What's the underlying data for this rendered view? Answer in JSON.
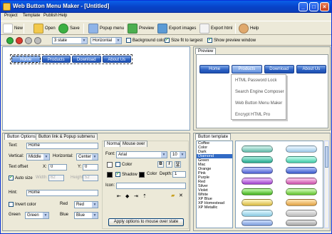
{
  "window": {
    "title": "Web Button Menu Maker - [Untitled]",
    "controls": {
      "minimize": "_",
      "maximize": "□",
      "close": "×"
    }
  },
  "menubar": [
    "Project",
    "Template",
    "Publish",
    "Help"
  ],
  "toolbar": {
    "new": "New",
    "open": "Open",
    "save": "Save",
    "popup_menu": "Popup menu",
    "preview": "Preview",
    "export_images": "Export images",
    "export_html": "Export html",
    "help": "Help"
  },
  "toolbar2": {
    "state_select": "3 state",
    "orientation_select": "Horizontal",
    "background_color": "Background color",
    "size_fit": "Size fit to largest",
    "show_preview": "Show preview window"
  },
  "editor": {
    "buttons": [
      "Home",
      "Products",
      "Download",
      "About Us"
    ]
  },
  "preview": {
    "tab": "Preview",
    "buttons": [
      "Home",
      "Products",
      "Download",
      "About Us"
    ],
    "submenu": [
      "HTML Password Lock",
      "Search Engine Composer",
      "Web Button Menu Maker",
      "Encrypt HTML Pro"
    ]
  },
  "options": {
    "tabs": [
      "Button Options",
      "Button link & Popup submenu"
    ],
    "text_label": "Text:",
    "text_value": "Home",
    "vertical_label": "Vertical:",
    "vertical_value": "Middle",
    "horizontal_label": "Horizontal:",
    "horizontal_value": "Center",
    "text_offset_label": "Text offset",
    "x_label": "X:",
    "x_value": "0",
    "y_label": "Y:",
    "y_value": "0",
    "autosize_label": "Auto size",
    "width_label": "Width:",
    "width_value": "62",
    "height_label": "Height:",
    "height_value": "52",
    "hint_label": "Hint:",
    "hint_value": "Home",
    "invert_label": "Invert color",
    "red_label": "Red",
    "red_value": "Red",
    "green_label": "Green",
    "green_value": "Green",
    "blue_label": "Blue",
    "blue_value": "Blue"
  },
  "font_panel": {
    "tabs": [
      "Normal",
      "Mouse over"
    ],
    "font_label": "Font:",
    "font_value": "Arial",
    "size_value": "10",
    "bold": "B",
    "italic": "I",
    "underline": "U",
    "color_label": "Color",
    "shadow_label": "Shadow",
    "shadow_color_label": "Color",
    "depth_label": "Depth:",
    "depth_value": "1",
    "icon_label": "Icon:",
    "apply_label": "Apply options to mouse over state"
  },
  "template": {
    "tab": "Button template",
    "items": [
      "Coffee",
      "Color",
      "Dark",
      "Diamond",
      "Green",
      "Mac",
      "Orange",
      "Pink",
      "Purple",
      "Red",
      "Silver",
      "Violet",
      "White",
      "XP Blue",
      "XP Homestead",
      "XP Metallic"
    ],
    "selected": "Diamond"
  },
  "colors": {
    "menu_button": "#2e63c4",
    "title_bar": "#0842c8",
    "selection": "#316ac5"
  }
}
